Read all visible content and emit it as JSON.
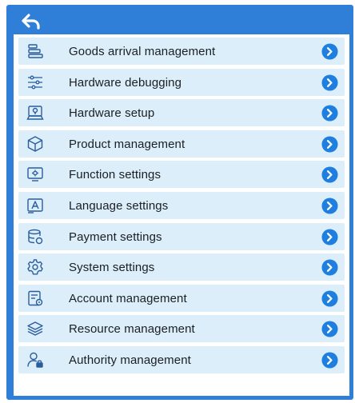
{
  "header": {
    "back_icon": "back-arrow-icon"
  },
  "colors": {
    "frame": "#2f7fd8",
    "row_bg": "#dbeefa",
    "icon_stroke": "#2b5d9e",
    "arrow_bg": "#1f7fe0"
  },
  "menu": {
    "items": [
      {
        "label": "Goods arrival management",
        "icon": "list-stack-icon"
      },
      {
        "label": "Hardware debugging",
        "icon": "sliders-icon"
      },
      {
        "label": "Hardware setup",
        "icon": "device-setup-icon"
      },
      {
        "label": "Product management",
        "icon": "box-icon"
      },
      {
        "label": "Function settings",
        "icon": "monitor-gear-icon"
      },
      {
        "label": "Language settings",
        "icon": "language-icon"
      },
      {
        "label": "Payment settings",
        "icon": "database-payment-icon"
      },
      {
        "label": "System settings",
        "icon": "gear-icon"
      },
      {
        "label": "Account management",
        "icon": "account-card-icon"
      },
      {
        "label": "Resource management",
        "icon": "layers-icon"
      },
      {
        "label": "Authority management",
        "icon": "user-lock-icon"
      }
    ]
  }
}
